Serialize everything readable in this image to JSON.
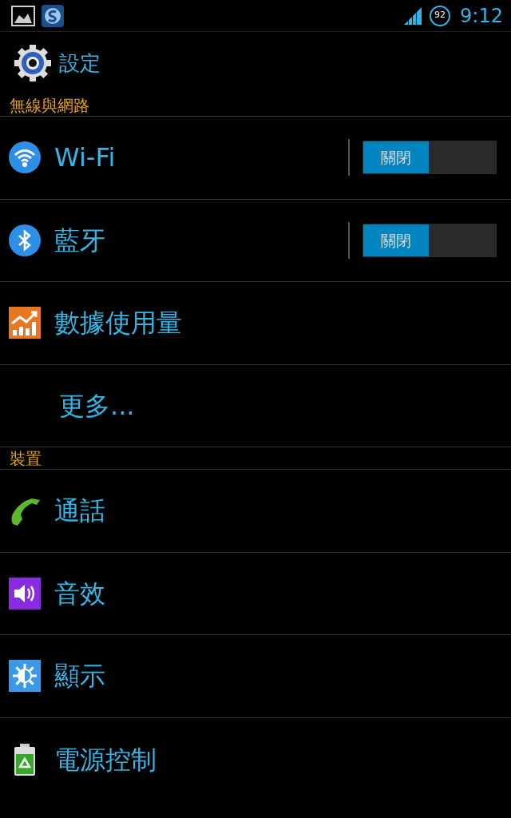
{
  "status_bar": {
    "battery": "92",
    "time": "9:12"
  },
  "title": "設定",
  "sections": [
    {
      "header": "無線與網路",
      "items": [
        {
          "label": "Wi-Fi",
          "kind": "toggle",
          "toggle": {
            "label": "關閉",
            "on": false
          }
        },
        {
          "label": "藍牙",
          "kind": "toggle",
          "toggle": {
            "label": "關閉",
            "on": false
          }
        },
        {
          "label": "數據使用量",
          "kind": "link"
        },
        {
          "label": "更多...",
          "kind": "link"
        }
      ]
    },
    {
      "header": "裝置",
      "items": [
        {
          "label": "通話",
          "kind": "link"
        },
        {
          "label": "音效",
          "kind": "link"
        },
        {
          "label": "顯示",
          "kind": "link"
        },
        {
          "label": "電源控制",
          "kind": "link"
        }
      ]
    }
  ]
}
